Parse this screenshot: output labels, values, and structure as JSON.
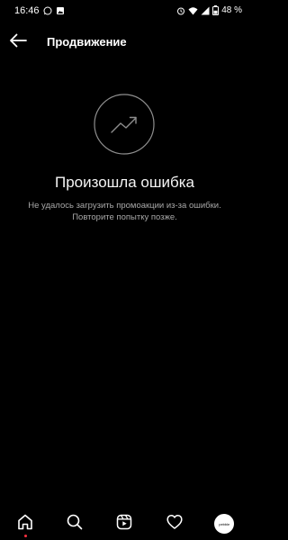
{
  "status_bar": {
    "time": "16:46",
    "battery": "48 %",
    "left_icons": [
      "whatsapp-icon",
      "gallery-icon"
    ],
    "right_icons": [
      "alarm-icon",
      "wifi-icon",
      "signal-icon",
      "battery-icon"
    ]
  },
  "header": {
    "title": "Продвижение",
    "back_icon": "arrow-left-icon"
  },
  "error": {
    "icon": "trending-up-icon",
    "title": "Произошла ошибка",
    "message": "Не удалось загрузить промоакции из-за ошибки. Повторите попытку позже."
  },
  "bottom_nav": {
    "items": [
      {
        "name": "home",
        "icon": "home-icon"
      },
      {
        "name": "search",
        "icon": "search-icon"
      },
      {
        "name": "reels",
        "icon": "reels-icon"
      },
      {
        "name": "activity",
        "icon": "heart-icon"
      },
      {
        "name": "profile",
        "icon": "avatar"
      }
    ],
    "avatar_text": "pebble",
    "notification_color": "#ff3040"
  },
  "colors": {
    "background": "#000000",
    "text_primary": "#ffffff",
    "text_secondary": "#a8a8a8"
  }
}
